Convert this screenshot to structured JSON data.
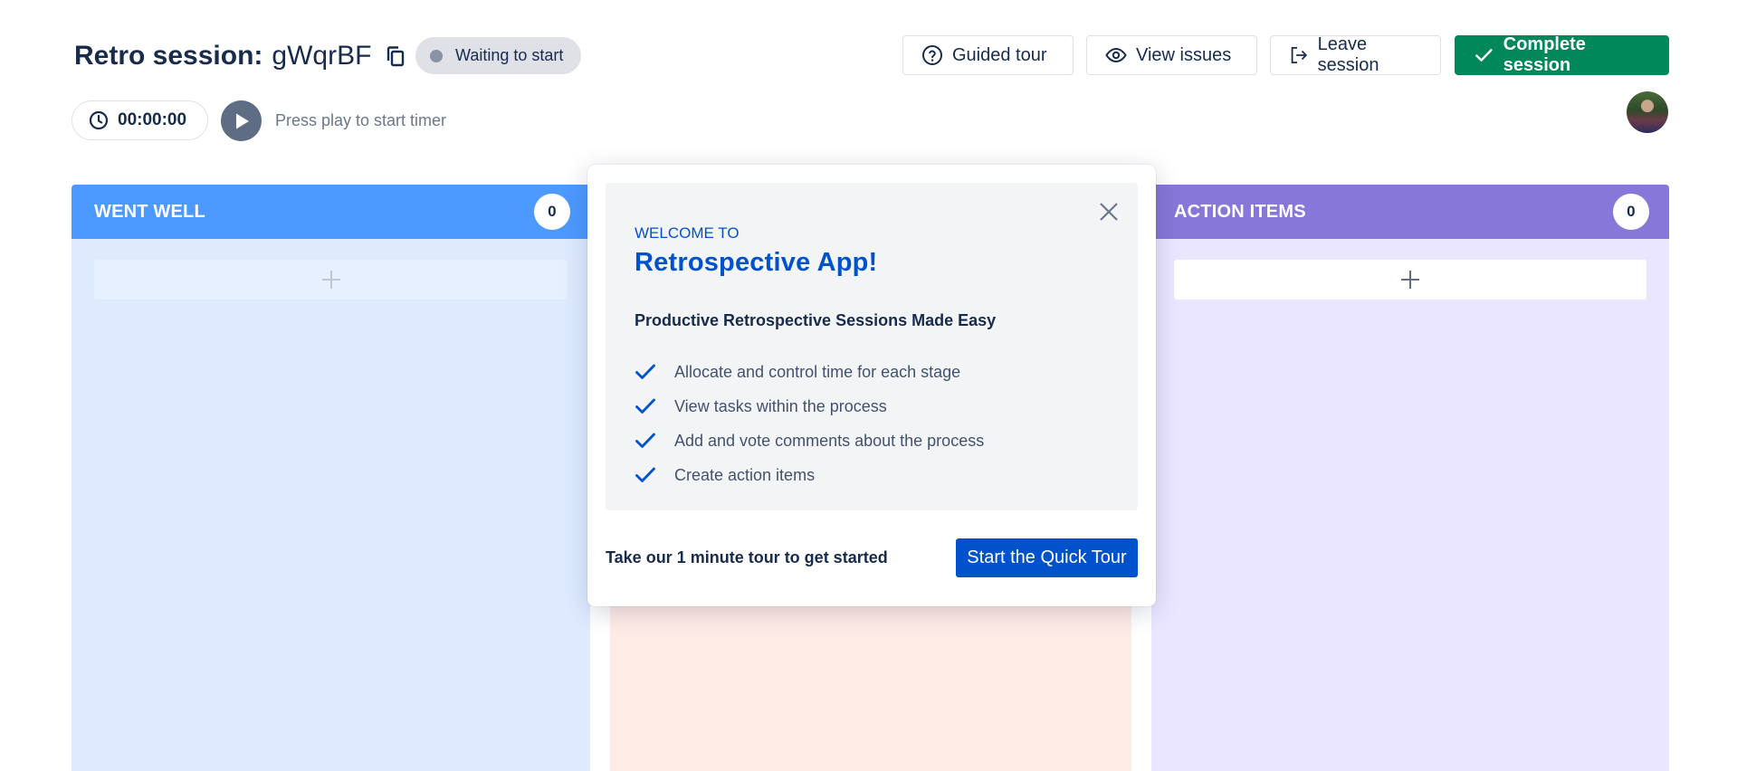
{
  "header": {
    "title_label": "Retro session:",
    "session_id": "gWqrBF",
    "status": "Waiting to start",
    "buttons": {
      "guided_tour": "Guided tour",
      "view_issues": "View issues",
      "leave_session": "Leave session",
      "complete_session": "Complete session"
    }
  },
  "timer": {
    "value": "00:00:00",
    "hint": "Press play to start timer"
  },
  "columns": [
    {
      "title": "WENT WELL",
      "count": "0",
      "color": "#4c9aff",
      "bg": "#deebff"
    },
    {
      "title": "",
      "count": "",
      "color": "#ff8f73",
      "bg": "#ffebe6"
    },
    {
      "title": "ACTION ITEMS",
      "count": "0",
      "color": "#8777d9",
      "bg": "#eae6ff"
    }
  ],
  "modal": {
    "welcome": "WELCOME TO",
    "app_name": "Retrospective App!",
    "subtitle": "Productive Retrospective Sessions Made Easy",
    "features": [
      "Allocate and control time for each stage",
      "View tasks within the process",
      "Add and vote comments about the process",
      "Create action items"
    ],
    "footer_text": "Take our 1 minute tour to get started",
    "cta": "Start the Quick Tour"
  },
  "colors": {
    "primary": "#0052cc",
    "success": "#00875a",
    "text": "#172b4d"
  },
  "icons": [
    "copy-icon",
    "question-circle-icon",
    "eye-icon",
    "logout-icon",
    "check-icon",
    "clock-icon",
    "play-icon",
    "plus-icon",
    "close-icon"
  ]
}
